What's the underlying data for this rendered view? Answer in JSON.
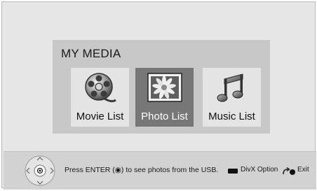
{
  "menu": {
    "title": "MY MEDIA",
    "items": [
      {
        "label": "Movie List",
        "icon": "film-reel-icon",
        "selected": false
      },
      {
        "label": "Photo List",
        "icon": "photo-icon",
        "selected": true
      },
      {
        "label": "Music List",
        "icon": "music-note-icon",
        "selected": false
      }
    ]
  },
  "footer": {
    "hint": "Press ENTER (◉) to see photos from the USB.",
    "divx_label": "DivX Option",
    "exit_label": "Exit"
  },
  "colors": {
    "background": "#e6e6e6",
    "panel": "#c8c8c8",
    "selected_tile": "#777777",
    "footer": "#d2d2d2"
  }
}
